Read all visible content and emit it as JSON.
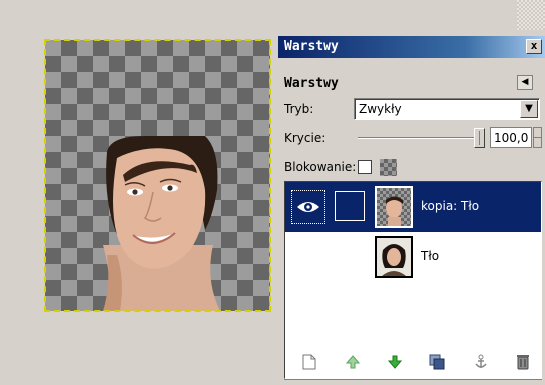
{
  "canvas": {
    "image_description_icon": "person-photo"
  },
  "dock": {
    "window_title": "Warstwy",
    "close_label": "x",
    "panel_title": "Warstwy",
    "mode_label": "Tryb:",
    "mode_value": "Zwykły",
    "opacity_label": "Krycie:",
    "opacity_value": "100,0",
    "opacity_fraction": 1.0,
    "lock_label": "Blokowanie:"
  },
  "layers": [
    {
      "name": "kopia: Tło",
      "selected": true,
      "visible": true
    },
    {
      "name": "Tło",
      "selected": false,
      "visible": false
    }
  ],
  "toolbar": {
    "icons": [
      "new-layer-icon",
      "raise-layer-icon",
      "lower-layer-icon",
      "duplicate-layer-icon",
      "anchor-layer-icon",
      "delete-layer-icon"
    ]
  },
  "colors": {
    "selection_bg": "#0a246a",
    "titlebar": "#0a246a",
    "arrow_green": "#2fa62f"
  }
}
